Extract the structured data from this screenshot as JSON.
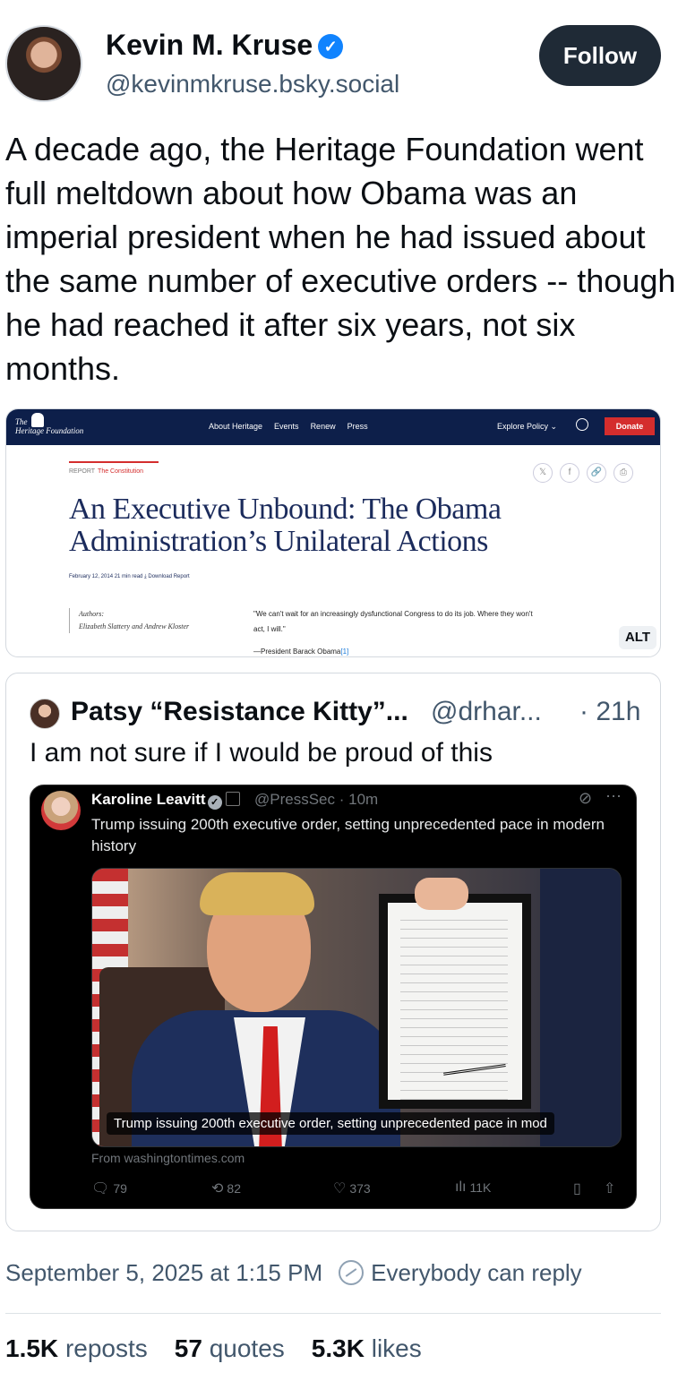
{
  "post": {
    "author_name": "Kevin M. Kruse",
    "verified_glyph": "✓",
    "handle": "@kevinmkruse.bsky.social",
    "follow_label": "Follow",
    "text": "A decade ago, the Heritage Foundation went full meltdown about how Obama was an imperial president when he had issued about the same number of executive orders -- though he had reached it after six years, not six months.",
    "timestamp": "September 5, 2025 at 1:15 PM",
    "reply_setting": "Everybody can reply"
  },
  "embed": {
    "site_logo_line1": "The",
    "site_logo_line2": "Heritage Foundation",
    "nav_links": [
      "About Heritage",
      "Events",
      "Renew",
      "Press"
    ],
    "explore": "Explore Policy ⌄",
    "donate": "Donate",
    "report_kind": "REPORT",
    "report_topic": "The Constitution",
    "share_icons": [
      "𝕏",
      "f",
      "🔗",
      "⎙"
    ],
    "title": "An Executive Unbound: The Obama Administration’s Unilateral Actions",
    "meta": "February 12, 2014   21 min read   ⤓ Download Report",
    "authors_label": "Authors:",
    "authors": "Elizabeth Slattery and Andrew Kloster",
    "quote": "\"We can't wait for an increasingly dysfunctional Congress to do its job. Where they won't act, I will.\"",
    "quote_cite": "—President Barack Obama",
    "quote_ref": "[1]",
    "alt_label": "ALT"
  },
  "quoted": {
    "author_name": "Patsy “Resistance Kitty”...",
    "handle": "@drhar...",
    "time": "· 21h",
    "text": "I am not sure if I would be proud of this",
    "inner": {
      "author_name": "Karoline Leavitt",
      "handle": "@PressSec · 10m",
      "text": "Trump issuing 200th executive order, setting unprecedented pace in modern history",
      "photo_caption": "Trump issuing 200th executive order, setting unprecedented pace in mod",
      "source": "From washingtontimes.com",
      "replies": "79",
      "reposts": "82",
      "likes": "373",
      "views": "11K"
    }
  },
  "stats": {
    "reposts_count": "1.5K",
    "reposts_label": "reposts",
    "quotes_count": "57",
    "quotes_label": "quotes",
    "likes_count": "5.3K",
    "likes_label": "likes"
  }
}
